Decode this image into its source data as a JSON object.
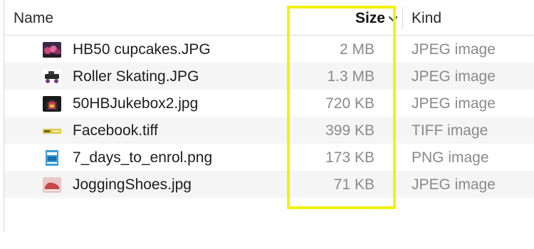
{
  "columns": {
    "name": "Name",
    "size": "Size",
    "kind": "Kind"
  },
  "sort": {
    "column": "size",
    "direction": "descending",
    "icon": "chevron-down-icon"
  },
  "highlight_color": "#f2f20f",
  "files": [
    {
      "name": "HB50 cupcakes.JPG",
      "size": "2 MB",
      "kind": "JPEG image",
      "thumb": "photo-thumbnail-cupcakes"
    },
    {
      "name": "Roller Skating.JPG",
      "size": "1.3 MB",
      "kind": "JPEG image",
      "thumb": "photo-thumbnail-skates"
    },
    {
      "name": "50HBJukebox2.jpg",
      "size": "720 KB",
      "kind": "JPEG image",
      "thumb": "photo-thumbnail-jukebox"
    },
    {
      "name": "Facebook.tiff",
      "size": "399 KB",
      "kind": "TIFF image",
      "thumb": "image-thumbnail-banner"
    },
    {
      "name": "7_days_to_enrol.png",
      "size": "173 KB",
      "kind": "PNG image",
      "thumb": "image-thumbnail-poster"
    },
    {
      "name": "JoggingShoes.jpg",
      "size": "71 KB",
      "kind": "JPEG image",
      "thumb": "photo-thumbnail-shoes"
    }
  ]
}
